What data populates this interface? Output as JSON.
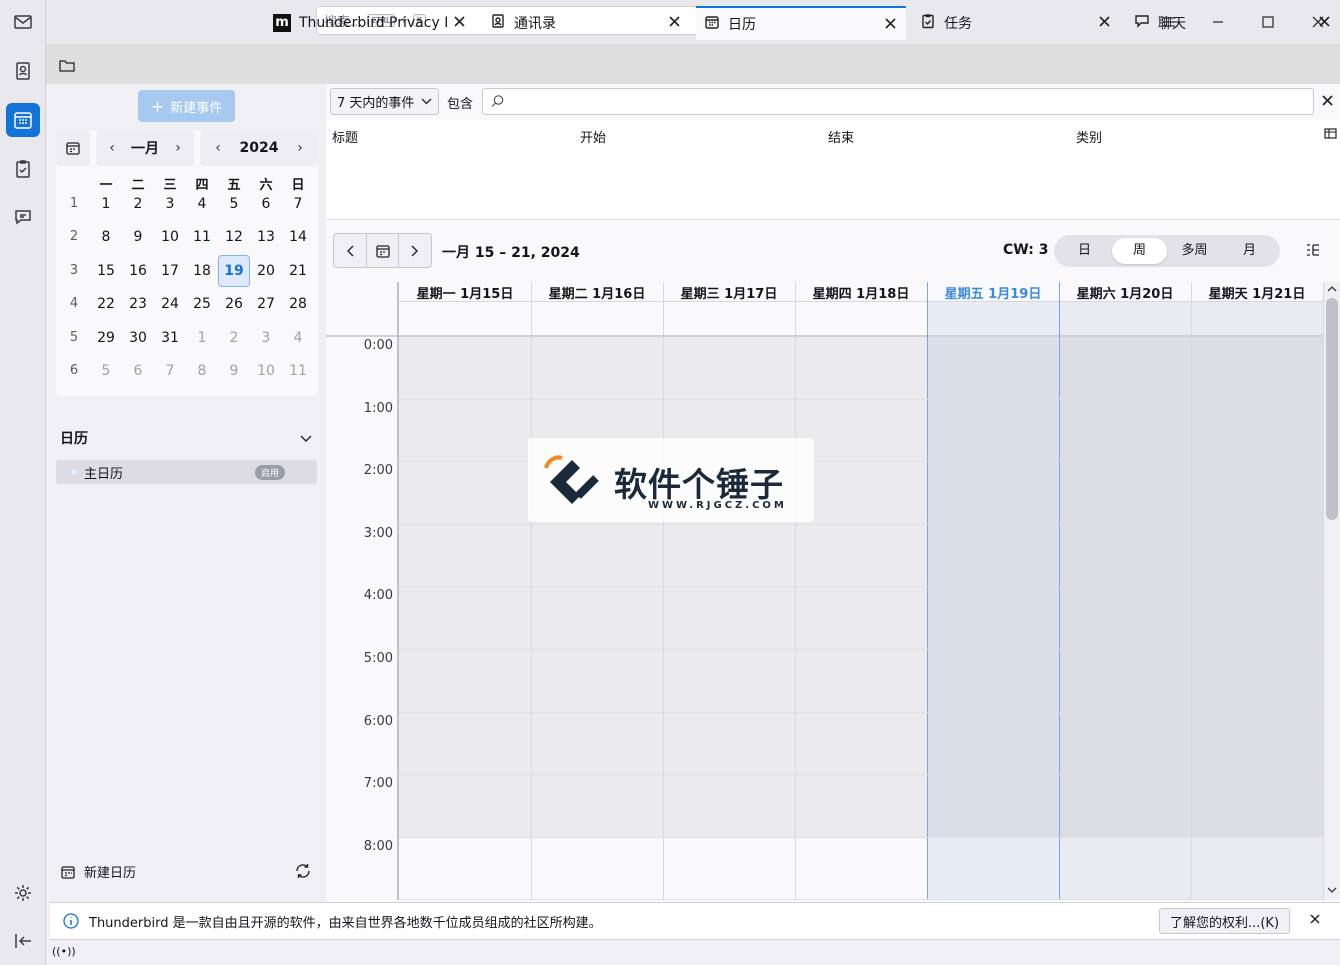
{
  "titlebar": {
    "search_placeholder": "搜索...",
    "kbd_ctrl": "CTRL",
    "kbd_plus": "+",
    "kbd_k": "K"
  },
  "tabs": [
    {
      "label": "Thunderbird Privacy No",
      "icon": "mozilla-icon"
    },
    {
      "label": "通讯录",
      "icon": "address-book-icon"
    },
    {
      "label": "日历",
      "icon": "calendar-icon",
      "active": true
    },
    {
      "label": "任务",
      "icon": "tasks-icon"
    },
    {
      "label": "聊天",
      "icon": "chat-icon"
    }
  ],
  "sidebar": {
    "new_event": "新建事件",
    "minimonth": {
      "month": "一月",
      "year": "2024",
      "weekdays": [
        "一",
        "二",
        "三",
        "四",
        "五",
        "六",
        "日"
      ],
      "weeks": [
        {
          "cw": "1",
          "days": [
            "1",
            "2",
            "3",
            "4",
            "5",
            "6",
            "7"
          ]
        },
        {
          "cw": "2",
          "days": [
            "8",
            "9",
            "10",
            "11",
            "12",
            "13",
            "14"
          ]
        },
        {
          "cw": "3",
          "days": [
            "15",
            "16",
            "17",
            "18",
            "19",
            "20",
            "21"
          ]
        },
        {
          "cw": "4",
          "days": [
            "22",
            "23",
            "24",
            "25",
            "26",
            "27",
            "28"
          ]
        },
        {
          "cw": "5",
          "days": [
            "29",
            "30",
            "31",
            "1",
            "2",
            "3",
            "4"
          ]
        },
        {
          "cw": "6",
          "days": [
            "5",
            "6",
            "7",
            "8",
            "9",
            "10",
            "11"
          ]
        }
      ],
      "today": "19"
    },
    "calendars_heading": "日历",
    "calendar_item": "主日历",
    "calendar_badge": "启用",
    "new_calendar": "新建日历"
  },
  "filter": {
    "selected": "7 天内的事件",
    "contains_label": "包含"
  },
  "list_headers": [
    "标题",
    "开始",
    "结束",
    "类别"
  ],
  "view": {
    "range_title": "一月 15 – 21, 2024",
    "cw_label": "CW: 3",
    "modes": [
      "日",
      "周",
      "多周",
      "月"
    ],
    "active_mode": "周",
    "day_headers": [
      "星期一 1月15日",
      "星期二 1月16日",
      "星期三 1月17日",
      "星期四 1月18日",
      "星期五 1月19日",
      "星期六 1月20日",
      "星期天 1月21日"
    ],
    "today_index": 4,
    "hours": [
      "0:00",
      "1:00",
      "2:00",
      "3:00",
      "4:00",
      "5:00",
      "6:00",
      "7:00",
      "8:00"
    ]
  },
  "watermark": {
    "text": "软件个锤子",
    "url": "WWW.RJGCZ.COM"
  },
  "notification": {
    "text": "Thunderbird 是一款自由且开源的软件，由来自世界各地数千位成员组成的社区所构建。",
    "button": "了解您的权利...(K)"
  },
  "colors": {
    "accent": "#1373d9",
    "today_bg": "#e8eef8"
  }
}
